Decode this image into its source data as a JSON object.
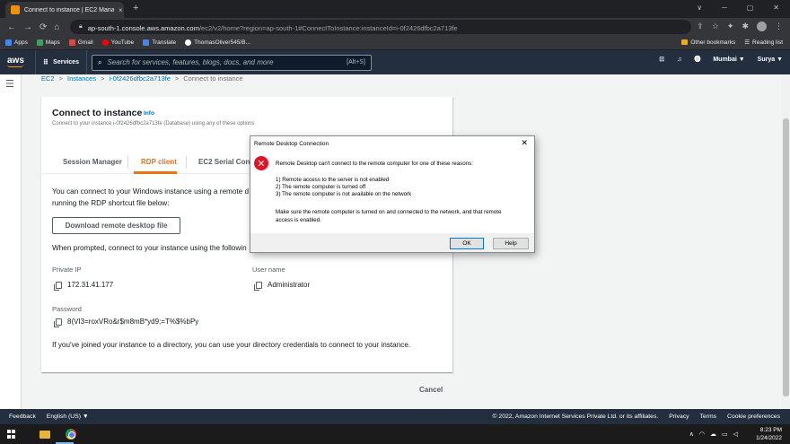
{
  "browser": {
    "tab_title": "Connect to instance | EC2 Manag",
    "tab_close": "×",
    "new_tab": "+",
    "window_controls": [
      "∨",
      "─",
      "▢",
      "✕"
    ],
    "url_host": "ap-south-1.console.aws.amazon.com",
    "url_path": "/ec2/v2/home?region=ap-south-1#ConnectToInstance:instanceId=i-0f2426dfbc2a713fe",
    "bookmarks": [
      "Apps",
      "Maps",
      "Gmail",
      "YouTube",
      "Translate",
      "ThomasOliver545/B..."
    ],
    "bookmark_colors": [
      "#4285f4",
      "#34a853",
      "#ea4335",
      "#ff0000",
      "#4285f4",
      "#ffffff"
    ],
    "other_bookmarks": "Other bookmarks",
    "reading_list": "Reading list"
  },
  "aws_nav": {
    "logo": "aws",
    "services": "Services",
    "search_placeholder": "Search for services, features, blogs, docs, and more",
    "search_shortcut": "[Alt+S]",
    "region": "Mumbai ▼",
    "user": "Surya ▼"
  },
  "breadcrumb": {
    "items": [
      "EC2",
      "Instances",
      "i-0f2426dfbc2a713fe"
    ],
    "current": "Connect to instance",
    "separator": ">"
  },
  "card": {
    "title": "Connect to instance",
    "info": "Info",
    "subtitle": "Connect to your instance i-0f2426dfbc2a713fe (Database) using any of these options",
    "tabs": [
      "Session Manager",
      "RDP client",
      "EC2 Serial Cons"
    ],
    "line1": "You can connect to your Windows instance using a remote d",
    "line2": "running the RDP shortcut file below:",
    "download_button": "Download remote desktop file",
    "prompt_text": "When prompted, connect to your instance using the followin",
    "private_ip_label": "Private IP",
    "private_ip_value": "172.31.41.177",
    "username_label": "User name",
    "username_value": "Administrator",
    "password_label": "Password",
    "password_value": "8(VI3=roxVRo&r$m8mB*yd9;=T%$%bPy",
    "directory_text": "If you've joined your instance to a directory, you can use your directory credentials to connect to your instance."
  },
  "cancel": "Cancel",
  "dialog": {
    "title": "Remote Desktop Connection",
    "close": "✕",
    "icon": "✕",
    "message": "Remote Desktop can't connect to the remote computer for one of these reasons:",
    "reason1": "1) Remote access to the server is not enabled",
    "reason2": "2) The remote computer is turned off",
    "reason3": "3) The remote computer is not available on the network",
    "advice1": "Make sure the remote computer is turned on and connected to the network, and that remote",
    "advice2": "access is enabled.",
    "ok": "OK",
    "help": "Help"
  },
  "footer": {
    "feedback": "Feedback",
    "language": "English (US) ▼",
    "copyright": "© 2022, Amazon Internet Services Private Ltd. or its affiliates.",
    "privacy": "Privacy",
    "terms": "Terms",
    "cookies": "Cookie preferences"
  },
  "taskbar": {
    "time": "8:23 PM",
    "date": "1/24/2022"
  },
  "colors": {
    "aws_orange": "#ec7211",
    "aws_nav": "#232f3e",
    "link_blue": "#0073bb",
    "error_red": "#e81123"
  }
}
